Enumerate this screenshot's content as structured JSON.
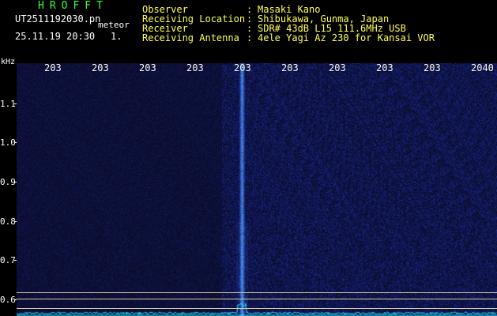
{
  "header": {
    "app_title": "HROFFT",
    "filename": "UT2511192030.pn",
    "mode": "meteor",
    "datetime": "25.11.19 20:30",
    "counter": "1."
  },
  "info": [
    {
      "key": "Observer",
      "value": "Masaki Kano"
    },
    {
      "key": "Receiving Location",
      "value": "Shibukawa, Gunma, Japan"
    },
    {
      "key": "Receiver",
      "value": "SDR# 43dB L15 111.6MHz USB"
    },
    {
      "key": "Receiving Antenna",
      "value": "4ele Yagi Az 230 for Kansai VOR"
    }
  ],
  "spectrogram": {
    "y_unit": "kHz",
    "y_ticks": [
      "1.1",
      "1.0",
      "0.9",
      "0.8",
      "0.7",
      "0.6"
    ],
    "x_ticks": [
      "203",
      "203",
      "203",
      "203",
      "203",
      "203",
      "203",
      "203",
      "203",
      "2040"
    ],
    "colors": {
      "background": "#030318",
      "noise": "#1a2a9a",
      "signal": "#4c9cff",
      "spectrum_trace": "#22e0ff",
      "marker_line": "#d8c89a"
    }
  }
}
